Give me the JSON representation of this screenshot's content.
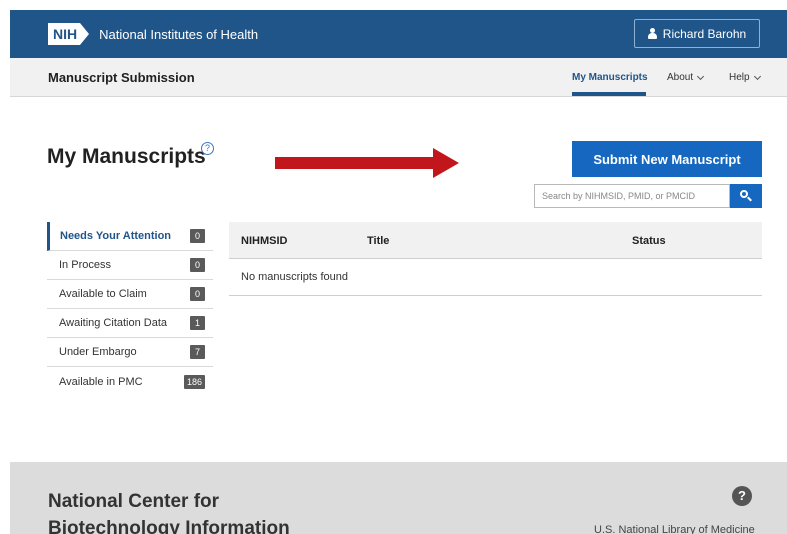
{
  "header": {
    "logo_text": "NIH",
    "org_name": "National Institutes of Health",
    "user_name": "Richard Barohn"
  },
  "subnav": {
    "title": "Manuscript Submission",
    "tabs": [
      {
        "label": "My Manuscripts",
        "active": true
      },
      {
        "label": "About",
        "active": false
      },
      {
        "label": "Help",
        "active": false
      }
    ]
  },
  "main": {
    "title": "My Manuscripts",
    "help_icon": "question-circle-icon",
    "submit_label": "Submit New Manuscript",
    "search_placeholder": "Search by NIHMSID, PMID, or PMCID",
    "annotation_arrow_color": "#c0161c"
  },
  "statuses": [
    {
      "label": "Needs Your Attention",
      "count": "0",
      "active": true
    },
    {
      "label": "In Process",
      "count": "0",
      "active": false
    },
    {
      "label": "Available to Claim",
      "count": "0",
      "active": false
    },
    {
      "label": "Awaiting Citation Data",
      "count": "1",
      "active": false
    },
    {
      "label": "Under Embargo",
      "count": "7",
      "active": false
    },
    {
      "label": "Available in PMC",
      "count": "186",
      "active": false
    }
  ],
  "table": {
    "columns": [
      "NIHMSID",
      "Title",
      "Status"
    ],
    "empty_message": "No manuscripts found"
  },
  "footer": {
    "title": "National Center for Biotechnology Information",
    "help_symbol": "?",
    "org": "U.S. National Library of Medicine"
  },
  "colors": {
    "brand": "#20558a",
    "button": "#1567c0"
  }
}
